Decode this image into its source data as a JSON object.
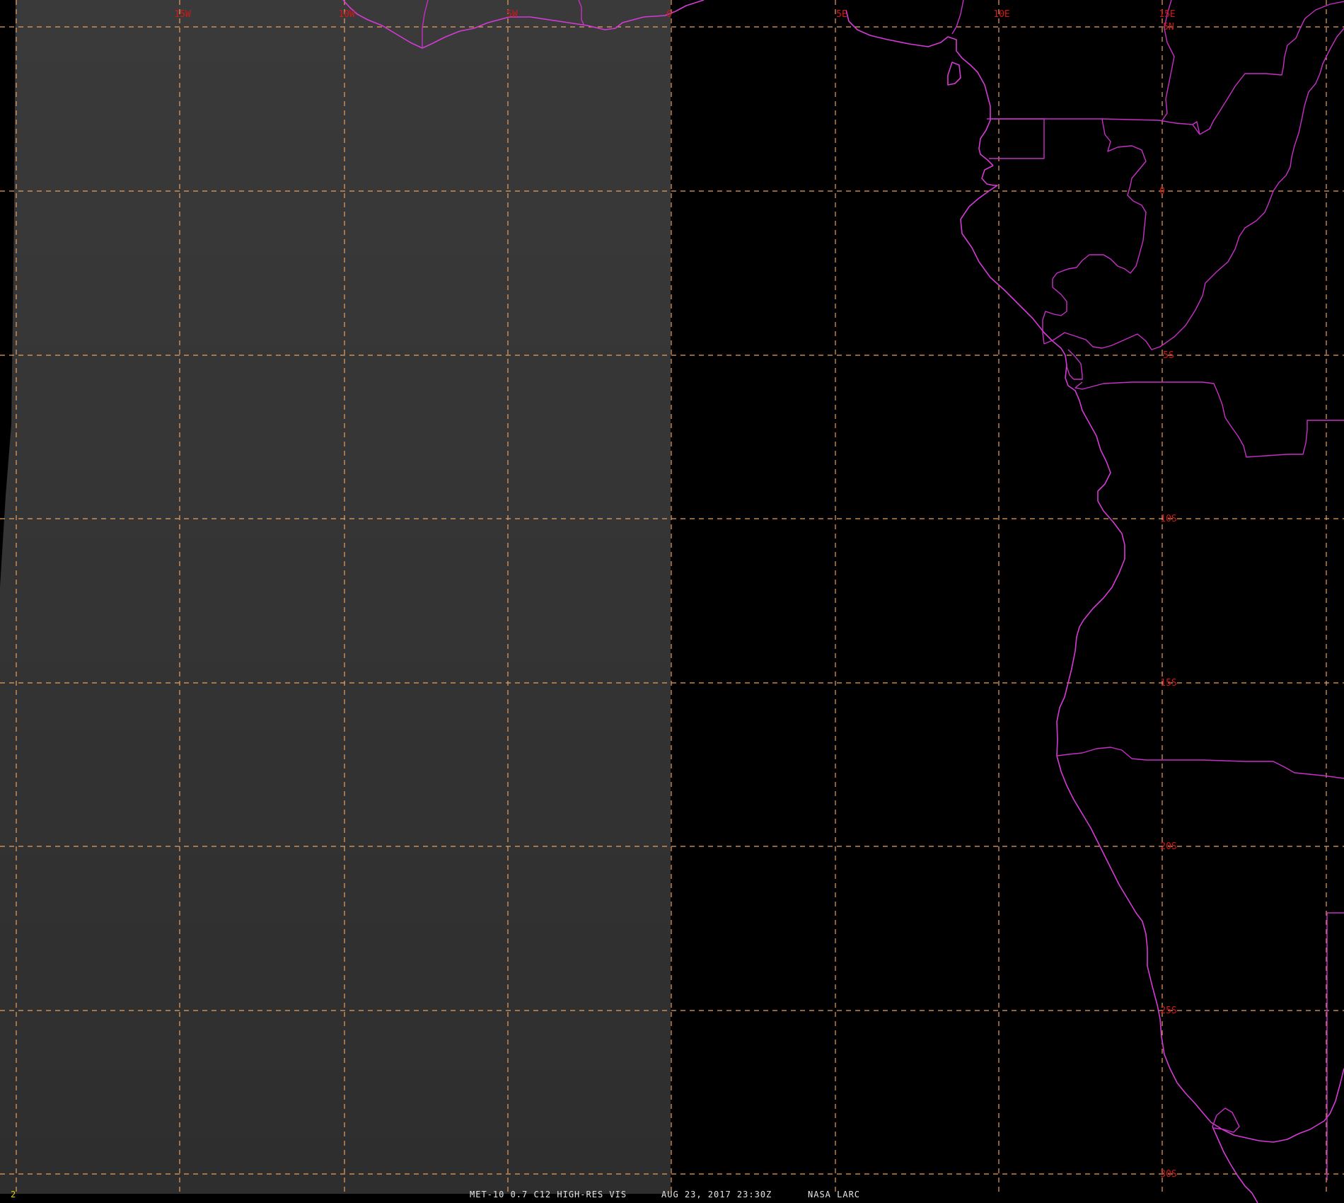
{
  "product": "MET-10 0.7 C12 HIGH-RES VIS",
  "timestamp": "AUG 23, 2017 23:30Z",
  "source": "NASA LARC",
  "frame_number": "2",
  "longitude_labels": [
    "15W",
    "10W",
    "5W",
    "0",
    "5E",
    "10E",
    "15E"
  ],
  "latitude_labels": [
    "5N",
    "0",
    "5S",
    "10S",
    "15S",
    "20S",
    "25S",
    "30S"
  ],
  "colors": {
    "background": "#000000",
    "sunlit_region": "#333333",
    "grid": "#e8a060",
    "coastline": "#d63ad6",
    "labels": "#d01818",
    "caption": "#e6e6e6"
  }
}
